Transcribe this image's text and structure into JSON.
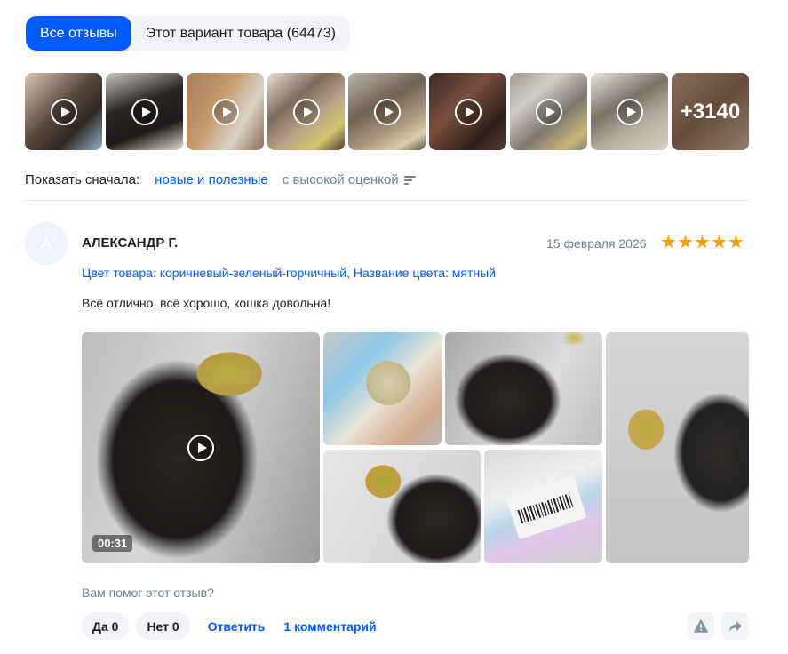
{
  "tabs": [
    {
      "label": "Все отзывы"
    },
    {
      "label": "Этот вариант товара (64473)"
    }
  ],
  "thumbs": {
    "more_label": "+3140"
  },
  "sort": {
    "label": "Показать сначала:",
    "option_active": "новые и полезные",
    "option_other": "с высокой оценкой"
  },
  "review": {
    "avatar_letter": "А",
    "author": "АЛЕКСАНДР Г.",
    "date": "15 февраля 2026",
    "rating": 5,
    "variant": "Цвет товара: коричневый-зеленый-горчичный, Название цвета: мятный",
    "text": "Всё отлично, всё хорошо, кошка довольна!",
    "video_duration": "00:31"
  },
  "feedback": {
    "question": "Вам помог этот отзыв?",
    "yes_label": "Да 0",
    "no_label": "Нет 0",
    "reply_label": "Ответить",
    "comments_label": "1 комментарий"
  },
  "icons": {
    "report": "warning-icon",
    "share": "share-icon"
  },
  "colors": {
    "accent": "#005bff",
    "star": "#ff9f0a"
  }
}
